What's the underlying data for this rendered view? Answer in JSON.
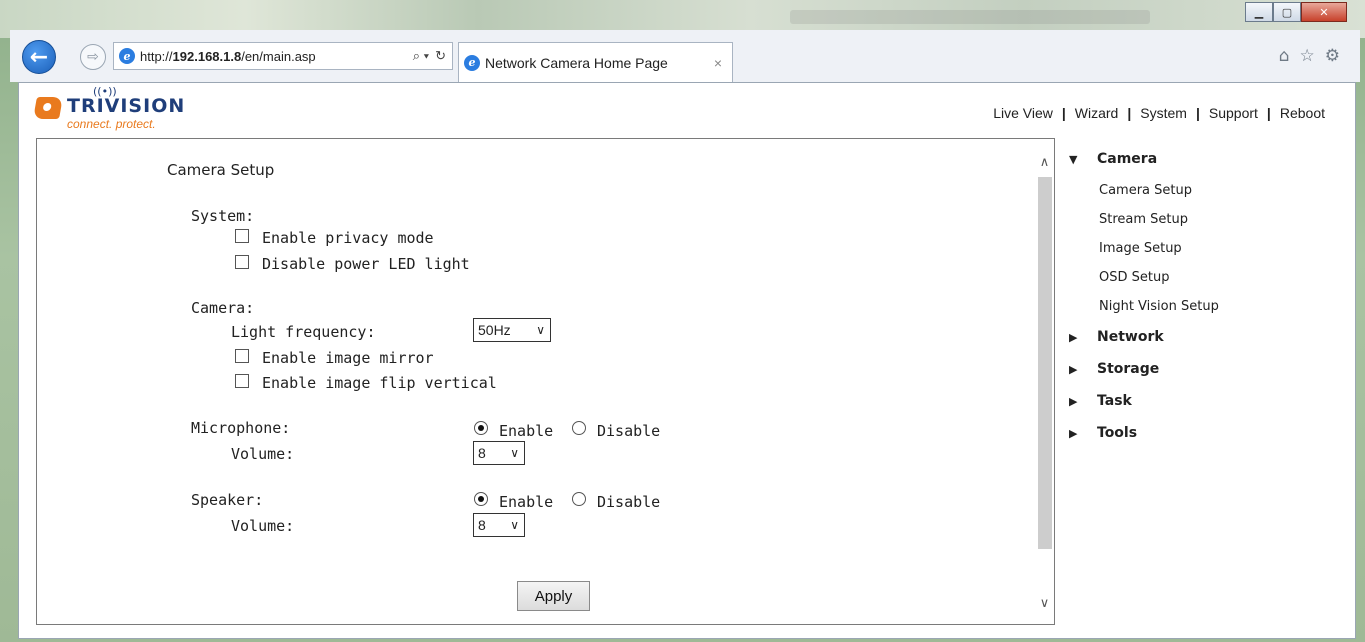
{
  "browser": {
    "url_prefix": "http://",
    "url_host": "192.168.1.8",
    "url_path": "/en/main.asp",
    "search_glyph": "⌕ ▾",
    "refresh_glyph": "↻",
    "tab_title": "Network Camera Home Page",
    "tab_close": "×",
    "back_glyph": "←",
    "forward_glyph": "⇨",
    "home_glyph": "⌂",
    "favorites_glyph": "☆",
    "settings_glyph": "⚙",
    "minimize_glyph": "▁",
    "maximize_glyph": "▢",
    "close_glyph": "✕"
  },
  "brand": {
    "name": "TRIVISION",
    "tagline": "connect. protect.",
    "wifi_glyph": "((•))",
    "colors": {
      "navy": "#1f3e7a",
      "orange": "#e97a1e"
    }
  },
  "top_nav": {
    "items": [
      "Live View",
      "Wizard",
      "System",
      "Support",
      "Reboot"
    ],
    "separator": "|"
  },
  "form": {
    "title": "Camera Setup",
    "system": {
      "label": "System:",
      "privacy_mode": {
        "label": "Enable privacy mode",
        "checked": false
      },
      "power_led": {
        "label": "Disable power LED light",
        "checked": false
      }
    },
    "camera": {
      "label": "Camera:",
      "light_frequency_label": "Light frequency:",
      "light_frequency_value": "50Hz",
      "image_mirror": {
        "label": "Enable image mirror",
        "checked": false
      },
      "image_flip": {
        "label": "Enable image flip vertical",
        "checked": false
      }
    },
    "microphone": {
      "label": "Microphone:",
      "enable_label": "Enable",
      "disable_label": "Disable",
      "selected": "Enable",
      "volume_label": "Volume:",
      "volume_value": "8"
    },
    "speaker": {
      "label": "Speaker:",
      "enable_label": "Enable",
      "disable_label": "Disable",
      "selected": "Enable",
      "volume_label": "Volume:",
      "volume_value": "8"
    },
    "apply_label": "Apply",
    "caret_glyph": "∨"
  },
  "sidebar": {
    "expanded_glyph": "▼",
    "collapsed_glyph": "▶",
    "sections": [
      {
        "label": "Camera",
        "expanded": true,
        "items": [
          "Camera Setup",
          "Stream Setup",
          "Image Setup",
          "OSD Setup",
          "Night Vision Setup"
        ]
      },
      {
        "label": "Network",
        "expanded": false
      },
      {
        "label": "Storage",
        "expanded": false
      },
      {
        "label": "Task",
        "expanded": false
      },
      {
        "label": "Tools",
        "expanded": false
      }
    ]
  },
  "scrollbar": {
    "up_glyph": "∧",
    "down_glyph": "∨"
  }
}
